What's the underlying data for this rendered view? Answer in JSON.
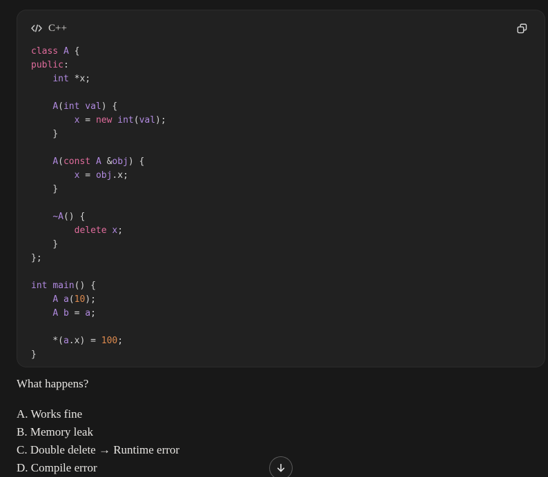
{
  "colors": {
    "page_bg": "#181818",
    "code_block_bg": "#212121",
    "keyword_pink": "#e06c9c",
    "identifier_purple": "#b18ae0",
    "number_orange": "#dd8a4e",
    "plain_code": "#d4d4d4",
    "body_text": "#e6e4e1"
  },
  "code_block": {
    "language_label": "C++",
    "header_icon": "code-icon",
    "copy_icon": "copy-icon",
    "lines": [
      [
        {
          "t": "class",
          "c": "k"
        },
        {
          "t": " ",
          "c": "p"
        },
        {
          "t": "A",
          "c": "t"
        },
        {
          "t": " {",
          "c": "p"
        }
      ],
      [
        {
          "t": "public",
          "c": "k"
        },
        {
          "t": ":",
          "c": "p"
        }
      ],
      [
        {
          "t": "    ",
          "c": "p"
        },
        {
          "t": "int",
          "c": "t"
        },
        {
          "t": " *x;",
          "c": "p"
        }
      ],
      [],
      [
        {
          "t": "    ",
          "c": "p"
        },
        {
          "t": "A",
          "c": "t"
        },
        {
          "t": "(",
          "c": "p"
        },
        {
          "t": "int",
          "c": "t"
        },
        {
          "t": " ",
          "c": "p"
        },
        {
          "t": "val",
          "c": "t"
        },
        {
          "t": ") {",
          "c": "p"
        }
      ],
      [
        {
          "t": "        ",
          "c": "p"
        },
        {
          "t": "x",
          "c": "t"
        },
        {
          "t": " = ",
          "c": "p"
        },
        {
          "t": "new",
          "c": "k"
        },
        {
          "t": " ",
          "c": "p"
        },
        {
          "t": "int",
          "c": "t"
        },
        {
          "t": "(",
          "c": "p"
        },
        {
          "t": "val",
          "c": "t"
        },
        {
          "t": ");",
          "c": "p"
        }
      ],
      [
        {
          "t": "    }",
          "c": "p"
        }
      ],
      [],
      [
        {
          "t": "    ",
          "c": "p"
        },
        {
          "t": "A",
          "c": "t"
        },
        {
          "t": "(",
          "c": "p"
        },
        {
          "t": "const",
          "c": "k"
        },
        {
          "t": " ",
          "c": "p"
        },
        {
          "t": "A",
          "c": "t"
        },
        {
          "t": " &",
          "c": "p"
        },
        {
          "t": "obj",
          "c": "t"
        },
        {
          "t": ") {",
          "c": "p"
        }
      ],
      [
        {
          "t": "        ",
          "c": "p"
        },
        {
          "t": "x",
          "c": "t"
        },
        {
          "t": " = ",
          "c": "p"
        },
        {
          "t": "obj",
          "c": "t"
        },
        {
          "t": ".x;",
          "c": "p"
        }
      ],
      [
        {
          "t": "    }",
          "c": "p"
        }
      ],
      [],
      [
        {
          "t": "    ",
          "c": "p"
        },
        {
          "t": "~A",
          "c": "t"
        },
        {
          "t": "() {",
          "c": "p"
        }
      ],
      [
        {
          "t": "        ",
          "c": "p"
        },
        {
          "t": "delete",
          "c": "k"
        },
        {
          "t": " ",
          "c": "p"
        },
        {
          "t": "x",
          "c": "t"
        },
        {
          "t": ";",
          "c": "p"
        }
      ],
      [
        {
          "t": "    }",
          "c": "p"
        }
      ],
      [
        {
          "t": "};",
          "c": "p"
        }
      ],
      [],
      [
        {
          "t": "int",
          "c": "t"
        },
        {
          "t": " ",
          "c": "p"
        },
        {
          "t": "main",
          "c": "t"
        },
        {
          "t": "() {",
          "c": "p"
        }
      ],
      [
        {
          "t": "    ",
          "c": "p"
        },
        {
          "t": "A",
          "c": "t"
        },
        {
          "t": " ",
          "c": "p"
        },
        {
          "t": "a",
          "c": "t"
        },
        {
          "t": "(",
          "c": "p"
        },
        {
          "t": "10",
          "c": "n"
        },
        {
          "t": ");",
          "c": "p"
        }
      ],
      [
        {
          "t": "    ",
          "c": "p"
        },
        {
          "t": "A",
          "c": "t"
        },
        {
          "t": " ",
          "c": "p"
        },
        {
          "t": "b",
          "c": "t"
        },
        {
          "t": " = ",
          "c": "p"
        },
        {
          "t": "a",
          "c": "t"
        },
        {
          "t": ";",
          "c": "p"
        }
      ],
      [],
      [
        {
          "t": "    *(",
          "c": "p"
        },
        {
          "t": "a",
          "c": "t"
        },
        {
          "t": ".x) = ",
          "c": "p"
        },
        {
          "t": "100",
          "c": "n"
        },
        {
          "t": ";",
          "c": "p"
        }
      ],
      [
        {
          "t": "}",
          "c": "p"
        }
      ]
    ]
  },
  "question": {
    "prompt": "What happens?",
    "options": [
      "A. Works fine",
      "B. Memory leak",
      "C. Double delete → Runtime error",
      "D. Compile error"
    ]
  },
  "scroll_button": {
    "icon": "arrow-down-icon"
  }
}
